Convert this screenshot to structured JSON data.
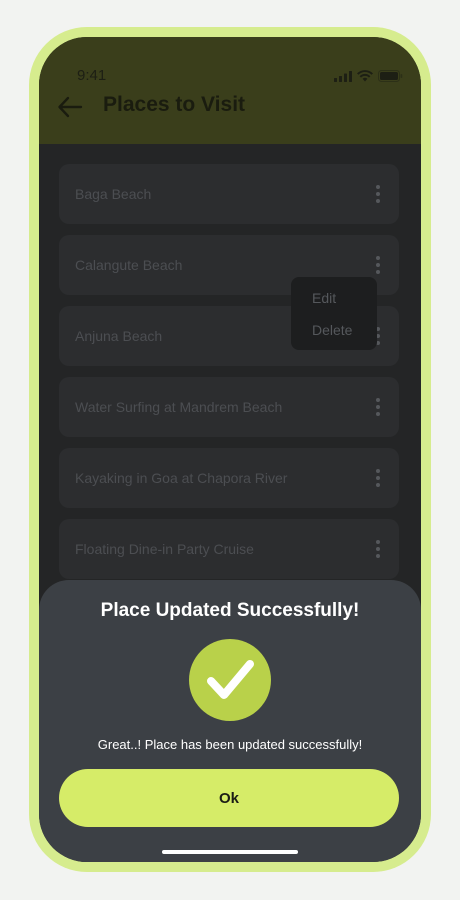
{
  "status_bar": {
    "time": "9:41"
  },
  "header": {
    "title": "Places to Visit",
    "back_icon": "arrow-left-icon"
  },
  "places": [
    {
      "label": "Baga Beach"
    },
    {
      "label": "Calangute Beach"
    },
    {
      "label": "Anjuna Beach"
    },
    {
      "label": "Water Surfing at Mandrem Beach"
    },
    {
      "label": "Kayaking in Goa at Chapora River"
    },
    {
      "label": "Floating Dine-in Party Cruise"
    }
  ],
  "context_menu": {
    "edit_label": "Edit",
    "delete_label": "Delete"
  },
  "dialog": {
    "title": "Place Updated Successfully!",
    "message": "Great..! Place has been updated successfully!",
    "ok_label": "Ok",
    "icon": "checkmark-icon"
  },
  "colors": {
    "accent": "#d6ec68",
    "success": "#b9d14a",
    "header_bg": "#3a3e1b",
    "sheet_bg": "#3c4045",
    "frame": "#d6ec8e"
  }
}
